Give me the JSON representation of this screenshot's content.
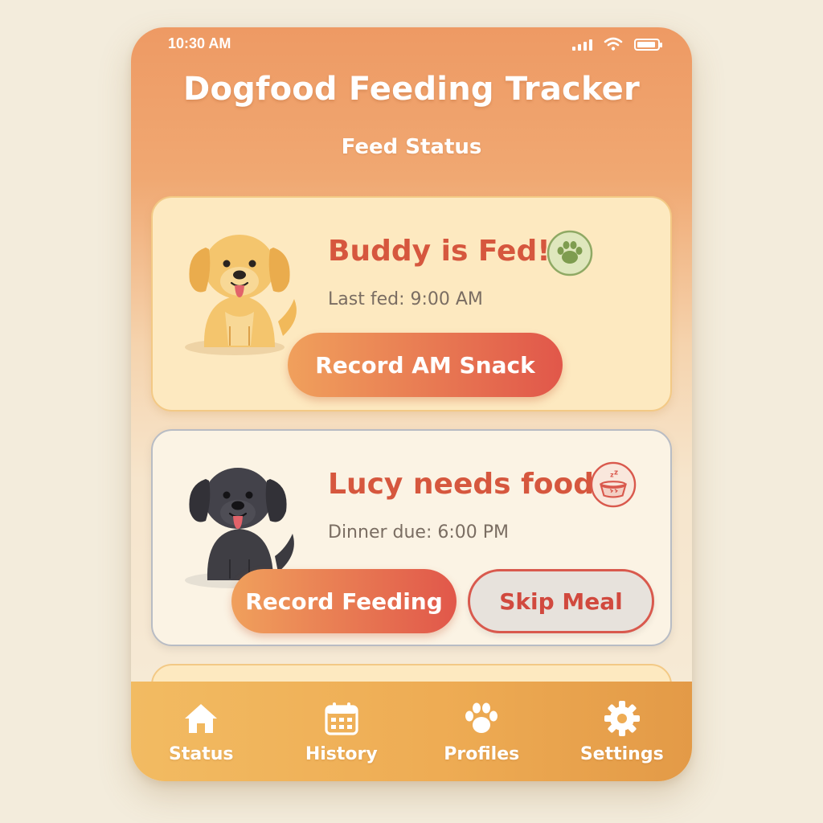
{
  "status_bar": {
    "time": "10:30 AM"
  },
  "app": {
    "title": "Dogfood Feeding Tracker",
    "section": "Feed Status"
  },
  "cards": [
    {
      "title": "Buddy is Fed!",
      "subtitle": "Last fed: 9:00 AM",
      "status_icon": "paw-icon",
      "primary_button": "Record AM Snack"
    },
    {
      "title": "Lucy needs food",
      "subtitle": "Dinner due: 6:00 PM",
      "status_icon": "empty-bowl-icon",
      "primary_button": "Record Feeding",
      "secondary_button": "Skip Meal"
    }
  ],
  "nav": [
    {
      "label": "Status",
      "icon": "home-icon"
    },
    {
      "label": "History",
      "icon": "calendar-icon"
    },
    {
      "label": "Profiles",
      "icon": "paw-icon"
    },
    {
      "label": "Settings",
      "icon": "gear-icon"
    }
  ],
  "colors": {
    "accent": "#d6573e",
    "header_gradient": "#ee9a64",
    "fed_card": "#fde9c0",
    "nav_bar": "#eeac54"
  }
}
